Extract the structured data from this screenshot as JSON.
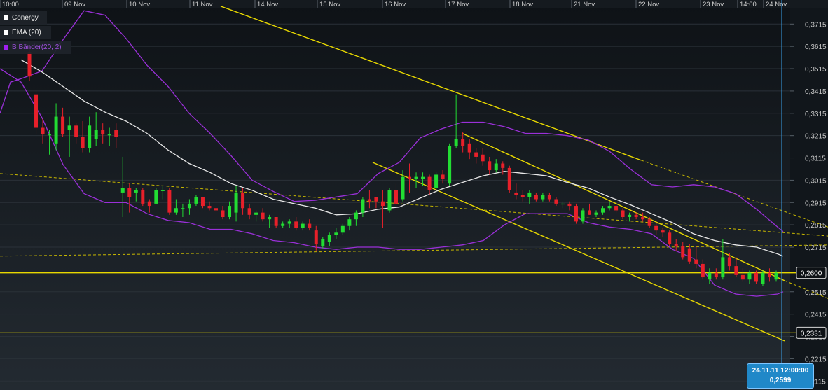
{
  "colors": {
    "background_top": "#0e1216",
    "background_bottom": "#232a31",
    "up_candle": "#22dd33",
    "down_candle": "#e8202a",
    "ema": "#e8e8e8",
    "bollinger": "#9a30d8",
    "trendline": "#e8d800",
    "dashed_trendline": "#c8b800",
    "crosshair": "#3aa0e8"
  },
  "legend": {
    "items": [
      {
        "label": "Conergy",
        "color": "#ffffff"
      },
      {
        "label": "EMA (20)",
        "color": "#ffffff"
      },
      {
        "label": "B Bänder(20, 2)",
        "color": "#a020f0"
      }
    ]
  },
  "crosshair": {
    "date_label": "24.11.11 12:00:00",
    "value_label": "0,2599"
  },
  "chart_data": {
    "type": "candlestick",
    "ylim": [
      0.2075,
      0.3785
    ],
    "y_ticks": [
      {
        "value": 0.3715,
        "label": "0,3715"
      },
      {
        "value": 0.3615,
        "label": "0,3615"
      },
      {
        "value": 0.3515,
        "label": "0,3515"
      },
      {
        "value": 0.3415,
        "label": "0,3415"
      },
      {
        "value": 0.3315,
        "label": "0,3315"
      },
      {
        "value": 0.3215,
        "label": "0,3215"
      },
      {
        "value": 0.3115,
        "label": "0,3115"
      },
      {
        "value": 0.3015,
        "label": "0,3015"
      },
      {
        "value": 0.2915,
        "label": "0,2915"
      },
      {
        "value": 0.2815,
        "label": "0,2815"
      },
      {
        "value": 0.2715,
        "label": "0,2715"
      },
      {
        "value": 0.2515,
        "label": "0,2515"
      },
      {
        "value": 0.2415,
        "label": "0,2415"
      },
      {
        "value": 0.2315,
        "label": "0,2315"
      },
      {
        "value": 0.2215,
        "label": "0,2215"
      },
      {
        "value": 0.2115,
        "label": "0,2115"
      }
    ],
    "x_labels": [
      "10:00",
      "09 Nov",
      "10 Nov",
      "11 Nov",
      "14 Nov",
      "15 Nov",
      "16 Nov",
      "17 Nov",
      "18 Nov",
      "21 Nov",
      "22 Nov",
      "23 Nov",
      "14:00",
      "24 Nov"
    ],
    "horizontal_levels": [
      {
        "value": 0.26,
        "label": "0,2600"
      },
      {
        "value": 0.2331,
        "label": "0,2331"
      }
    ],
    "series": [
      {
        "name": "Conergy",
        "ohlc": [
          [
            0.359,
            0.362,
            0.346,
            0.348
          ],
          [
            0.34,
            0.342,
            0.322,
            0.325
          ],
          [
            0.325,
            0.329,
            0.318,
            0.322
          ],
          [
            0.322,
            0.324,
            0.313,
            0.322
          ],
          [
            0.318,
            0.336,
            0.315,
            0.33
          ],
          [
            0.33,
            0.334,
            0.321,
            0.322
          ],
          [
            0.324,
            0.33,
            0.312,
            0.326
          ],
          [
            0.326,
            0.327,
            0.318,
            0.321
          ],
          [
            0.321,
            0.328,
            0.314,
            0.316
          ],
          [
            0.316,
            0.33,
            0.314,
            0.326
          ],
          [
            0.32,
            0.332,
            0.317,
            0.324
          ],
          [
            0.324,
            0.327,
            0.318,
            0.322
          ],
          [
            0.322,
            0.325,
            0.317,
            0.322
          ],
          [
            0.324,
            0.327,
            0.316,
            0.321
          ],
          [
            0.296,
            0.312,
            0.285,
            0.298
          ],
          [
            0.298,
            0.3,
            0.287,
            0.294
          ],
          [
            0.296,
            0.298,
            0.292,
            0.297
          ],
          [
            0.297,
            0.298,
            0.29,
            0.291
          ],
          [
            0.292,
            0.293,
            0.287,
            0.29
          ],
          [
            0.291,
            0.298,
            0.291,
            0.297
          ],
          [
            0.297,
            0.299,
            0.293,
            0.297
          ],
          [
            0.297,
            0.298,
            0.286,
            0.287
          ],
          [
            0.287,
            0.293,
            0.286,
            0.289
          ],
          [
            0.289,
            0.291,
            0.285,
            0.289
          ],
          [
            0.289,
            0.293,
            0.286,
            0.291
          ],
          [
            0.291,
            0.295,
            0.29,
            0.294
          ],
          [
            0.294,
            0.294,
            0.289,
            0.29
          ],
          [
            0.29,
            0.292,
            0.288,
            0.289
          ],
          [
            0.289,
            0.291,
            0.287,
            0.288
          ],
          [
            0.288,
            0.29,
            0.284,
            0.285
          ],
          [
            0.285,
            0.292,
            0.284,
            0.29
          ],
          [
            0.287,
            0.299,
            0.283,
            0.296
          ],
          [
            0.296,
            0.298,
            0.286,
            0.289
          ],
          [
            0.289,
            0.291,
            0.284,
            0.286
          ],
          [
            0.286,
            0.288,
            0.283,
            0.287
          ],
          [
            0.287,
            0.289,
            0.283,
            0.284
          ],
          [
            0.284,
            0.286,
            0.28,
            0.285
          ],
          [
            0.285,
            0.285,
            0.28,
            0.281
          ],
          [
            0.281,
            0.283,
            0.28,
            0.282
          ],
          [
            0.282,
            0.284,
            0.28,
            0.283
          ],
          [
            0.283,
            0.285,
            0.279,
            0.28
          ],
          [
            0.28,
            0.283,
            0.279,
            0.282
          ],
          [
            0.282,
            0.284,
            0.279,
            0.28
          ],
          [
            0.279,
            0.281,
            0.27,
            0.273
          ],
          [
            0.272,
            0.276,
            0.271,
            0.275
          ],
          [
            0.274,
            0.278,
            0.272,
            0.277
          ],
          [
            0.277,
            0.28,
            0.275,
            0.278
          ],
          [
            0.278,
            0.282,
            0.277,
            0.281
          ],
          [
            0.281,
            0.285,
            0.279,
            0.284
          ],
          [
            0.284,
            0.288,
            0.281,
            0.287
          ],
          [
            0.287,
            0.294,
            0.285,
            0.293
          ],
          [
            0.293,
            0.297,
            0.289,
            0.292
          ],
          [
            0.294,
            0.294,
            0.289,
            0.292
          ],
          [
            0.292,
            0.297,
            0.28,
            0.29
          ],
          [
            0.288,
            0.298,
            0.287,
            0.297
          ],
          [
            0.297,
            0.3,
            0.29,
            0.291
          ],
          [
            0.293,
            0.306,
            0.292,
            0.303
          ],
          [
            0.303,
            0.309,
            0.296,
            0.302
          ],
          [
            0.302,
            0.305,
            0.298,
            0.303
          ],
          [
            0.302,
            0.305,
            0.299,
            0.303
          ],
          [
            0.303,
            0.304,
            0.295,
            0.297
          ],
          [
            0.298,
            0.305,
            0.296,
            0.304
          ],
          [
            0.304,
            0.306,
            0.3,
            0.302
          ],
          [
            0.3,
            0.318,
            0.299,
            0.317
          ],
          [
            0.317,
            0.34,
            0.316,
            0.32
          ],
          [
            0.32,
            0.323,
            0.314,
            0.317
          ],
          [
            0.318,
            0.32,
            0.311,
            0.314
          ],
          [
            0.314,
            0.316,
            0.309,
            0.312
          ],
          [
            0.313,
            0.316,
            0.308,
            0.31
          ],
          [
            0.31,
            0.312,
            0.304,
            0.306
          ],
          [
            0.306,
            0.311,
            0.305,
            0.309
          ],
          [
            0.309,
            0.31,
            0.304,
            0.307
          ],
          [
            0.307,
            0.308,
            0.296,
            0.297
          ],
          [
            0.296,
            0.3,
            0.293,
            0.295
          ],
          [
            0.295,
            0.297,
            0.292,
            0.294
          ],
          [
            0.294,
            0.297,
            0.291,
            0.296
          ],
          [
            0.295,
            0.296,
            0.292,
            0.293
          ],
          [
            0.293,
            0.296,
            0.292,
            0.295
          ],
          [
            0.295,
            0.296,
            0.292,
            0.293
          ],
          [
            0.293,
            0.294,
            0.29,
            0.291
          ],
          [
            0.291,
            0.292,
            0.289,
            0.291
          ],
          [
            0.291,
            0.292,
            0.288,
            0.29
          ],
          [
            0.29,
            0.291,
            0.282,
            0.283
          ],
          [
            0.283,
            0.289,
            0.282,
            0.288
          ],
          [
            0.288,
            0.291,
            0.286,
            0.286
          ],
          [
            0.286,
            0.288,
            0.285,
            0.287
          ],
          [
            0.287,
            0.29,
            0.286,
            0.289
          ],
          [
            0.289,
            0.292,
            0.288,
            0.29
          ],
          [
            0.29,
            0.291,
            0.287,
            0.288
          ],
          [
            0.288,
            0.289,
            0.284,
            0.285
          ],
          [
            0.285,
            0.287,
            0.283,
            0.286
          ],
          [
            0.286,
            0.287,
            0.284,
            0.285
          ],
          [
            0.285,
            0.287,
            0.283,
            0.284
          ],
          [
            0.284,
            0.285,
            0.28,
            0.281
          ],
          [
            0.281,
            0.283,
            0.277,
            0.279
          ],
          [
            0.279,
            0.28,
            0.276,
            0.278
          ],
          [
            0.278,
            0.279,
            0.272,
            0.273
          ],
          [
            0.273,
            0.275,
            0.27,
            0.272
          ],
          [
            0.272,
            0.274,
            0.266,
            0.267
          ],
          [
            0.271,
            0.273,
            0.264,
            0.265
          ],
          [
            0.266,
            0.272,
            0.262,
            0.264
          ],
          [
            0.264,
            0.266,
            0.257,
            0.258
          ],
          [
            0.257,
            0.262,
            0.255,
            0.26
          ],
          [
            0.26,
            0.262,
            0.257,
            0.258
          ],
          [
            0.258,
            0.275,
            0.257,
            0.267
          ],
          [
            0.267,
            0.269,
            0.261,
            0.263
          ],
          [
            0.263,
            0.267,
            0.258,
            0.259
          ],
          [
            0.259,
            0.262,
            0.256,
            0.257
          ],
          [
            0.257,
            0.261,
            0.255,
            0.26
          ],
          [
            0.26,
            0.261,
            0.255,
            0.256
          ],
          [
            0.255,
            0.261,
            0.254,
            0.26
          ],
          [
            0.26,
            0.262,
            0.256,
            0.258
          ],
          [
            0.257,
            0.261,
            0.256,
            0.26
          ]
        ]
      },
      {
        "name": "EMA (20)",
        "x": [
          30,
          60,
          90,
          120,
          150,
          180,
          210,
          240,
          270,
          300,
          330,
          360,
          390,
          420,
          450,
          480,
          510,
          540,
          570,
          600,
          630,
          660,
          690,
          720,
          750,
          780,
          810,
          840,
          870,
          900,
          930,
          960,
          990,
          1020,
          1050,
          1080,
          1110,
          1118
        ],
        "y": [
          0.3555,
          0.35,
          0.3435,
          0.337,
          0.332,
          0.328,
          0.3225,
          0.315,
          0.309,
          0.305,
          0.3,
          0.297,
          0.293,
          0.291,
          0.289,
          0.286,
          0.2865,
          0.2885,
          0.2895,
          0.2935,
          0.2975,
          0.3005,
          0.3035,
          0.3055,
          0.3045,
          0.3035,
          0.3005,
          0.298,
          0.294,
          0.2905,
          0.2865,
          0.2825,
          0.2775,
          0.2745,
          0.2725,
          0.2715,
          0.2685,
          0.2675
        ]
      },
      {
        "name": "B Bänder(20, 2)",
        "x": [
          0,
          15,
          30,
          60,
          90,
          120,
          150,
          180,
          210,
          240,
          270,
          300,
          330,
          360,
          390,
          420,
          450,
          480,
          510,
          540,
          570,
          600,
          630,
          660,
          690,
          720,
          750,
          780,
          810,
          840,
          870,
          900,
          930,
          960,
          990,
          1020,
          1050,
          1080,
          1110,
          1118
        ],
        "y": [
          0.3315,
          0.3455,
          0.347,
          0.3505,
          0.3645,
          0.3775,
          0.3755,
          0.365,
          0.353,
          0.3435,
          0.3315,
          0.3225,
          0.3125,
          0.3015,
          0.2965,
          0.292,
          0.2925,
          0.294,
          0.2955,
          0.3045,
          0.3095,
          0.3205,
          0.3245,
          0.3275,
          0.3275,
          0.3255,
          0.3225,
          0.3225,
          0.3215,
          0.3195,
          0.3145,
          0.3065,
          0.2995,
          0.2985,
          0.2995,
          0.2985,
          0.2955,
          0.2885,
          0.2805,
          0.2785
        ],
        "lower": {
          "x": [
            0,
            30,
            60,
            90,
            120,
            150,
            180,
            210,
            240,
            270,
            300,
            330,
            360,
            390,
            420,
            450,
            480,
            510,
            540,
            570,
            600,
            630,
            660,
            690,
            720,
            750,
            780,
            810,
            840,
            870,
            900,
            930,
            960,
            990,
            1020,
            1050,
            1080,
            1110,
            1118
          ],
          "y": [
            0.3515,
            0.3455,
            0.3295,
            0.3085,
            0.2955,
            0.2915,
            0.2915,
            0.2865,
            0.2835,
            0.2825,
            0.2795,
            0.2795,
            0.2775,
            0.2745,
            0.2735,
            0.2715,
            0.2705,
            0.2715,
            0.2715,
            0.2705,
            0.2705,
            0.2715,
            0.2725,
            0.2745,
            0.2815,
            0.2865,
            0.2865,
            0.2865,
            0.2825,
            0.2805,
            0.2795,
            0.2775,
            0.2705,
            0.2665,
            0.2545,
            0.2505,
            0.2495,
            0.2505,
            0.2515
          ]
        }
      }
    ],
    "trendlines": [
      {
        "style": "solid",
        "x": [
          315,
          915
        ],
        "y": [
          0.3795,
          0.3105
        ]
      },
      {
        "style": "solid",
        "x": [
          660,
          1120
        ],
        "y": [
          0.3225,
          0.2565
        ]
      },
      {
        "style": "solid",
        "x": [
          532,
          1120
        ],
        "y": [
          0.3095,
          0.2295
        ]
      },
      {
        "style": "dashed",
        "x": [
          915,
          1182
        ],
        "y": [
          0.3105,
          0.2805
        ]
      },
      {
        "style": "dashed",
        "x": [
          1120,
          1182
        ],
        "y": [
          0.2565,
          0.2485
        ]
      },
      {
        "style": "dashed",
        "x": [
          0,
          1182
        ],
        "y": [
          0.3045,
          0.2765
        ]
      },
      {
        "style": "dashed",
        "x": [
          0,
          1182
        ],
        "y": [
          0.2675,
          0.2725
        ]
      }
    ]
  }
}
